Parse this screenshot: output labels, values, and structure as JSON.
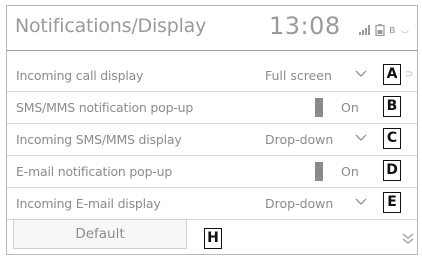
{
  "header": {
    "title": "Notifications/Display",
    "time": "13:08",
    "status_icons": [
      "signal-icon",
      "battery-icon",
      "bluetooth-icon"
    ]
  },
  "settings": [
    {
      "label": "Incoming call display",
      "value": "Full screen",
      "control": "dropdown",
      "callout": "A"
    },
    {
      "label": "SMS/MMS notification pop-up",
      "value": "On",
      "control": "toggle",
      "callout": "B"
    },
    {
      "label": "Incoming SMS/MMS display",
      "value": "Drop-down",
      "control": "dropdown",
      "callout": "C"
    },
    {
      "label": "E-mail notification pop-up",
      "value": "On",
      "control": "toggle",
      "callout": "D"
    },
    {
      "label": "Incoming E-mail display",
      "value": "Drop-down",
      "control": "dropdown",
      "callout": "E"
    }
  ],
  "footer": {
    "default_label": "Default",
    "callout": "H",
    "scroll_icon": "double-chevron-down-icon"
  },
  "colors": {
    "text": "#8c8c8c",
    "divider": "#d6d6d6",
    "toggle_indicator": "#8a8a8a",
    "callout_border": "#111111"
  }
}
